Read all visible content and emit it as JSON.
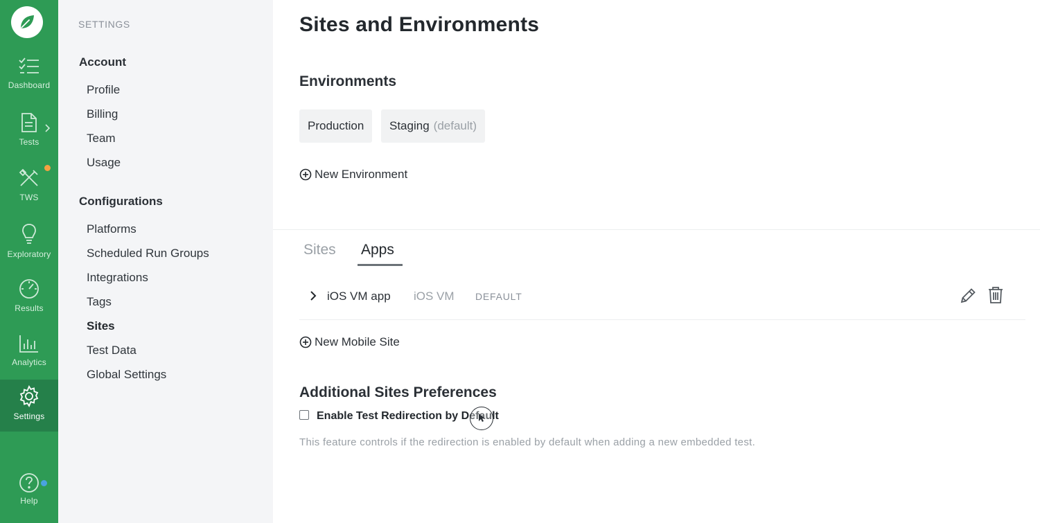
{
  "rail": {
    "items": [
      {
        "label": "Dashboard",
        "icon": "checklist-icon"
      },
      {
        "label": "Tests",
        "icon": "document-icon"
      },
      {
        "label": "TWS",
        "icon": "tools-icon"
      },
      {
        "label": "Exploratory",
        "icon": "lightbulb-icon"
      },
      {
        "label": "Results",
        "icon": "gauge-icon"
      },
      {
        "label": "Analytics",
        "icon": "bar-chart-icon"
      },
      {
        "label": "Settings",
        "icon": "gear-icon"
      },
      {
        "label": "Help",
        "icon": "question-circle-icon"
      }
    ],
    "active": "Settings",
    "colors": {
      "background": "#2e9b55",
      "active": "#25804a",
      "notify_orange": "#f5a142",
      "notify_blue": "#4aa3df"
    }
  },
  "sidebar": {
    "title": "SETTINGS",
    "groups": [
      {
        "label": "Account",
        "items": [
          "Profile",
          "Billing",
          "Team",
          "Usage"
        ]
      },
      {
        "label": "Configurations",
        "items": [
          "Platforms",
          "Scheduled Run Groups",
          "Integrations",
          "Tags",
          "Sites",
          "Test Data",
          "Global Settings"
        ]
      }
    ],
    "active_item": "Sites"
  },
  "main": {
    "title": "Sites and Environments",
    "environments": {
      "heading": "Environments",
      "items": [
        {
          "name": "Production",
          "suffix": ""
        },
        {
          "name": "Staging",
          "suffix": "(default)"
        }
      ],
      "add_label": "New Environment"
    },
    "tabs": [
      {
        "label": "Sites",
        "active": false
      },
      {
        "label": "Apps",
        "active": true
      }
    ],
    "apps": [
      {
        "name": "iOS VM app",
        "platform": "iOS VM",
        "badge": "DEFAULT"
      }
    ],
    "add_mobile_label": "New Mobile Site",
    "preferences": {
      "heading": "Additional Sites Preferences",
      "checkbox_label": "Enable Test Redirection by Default",
      "checked": false,
      "help": "This feature controls if the redirection is enabled by default when adding a new embedded test."
    }
  }
}
